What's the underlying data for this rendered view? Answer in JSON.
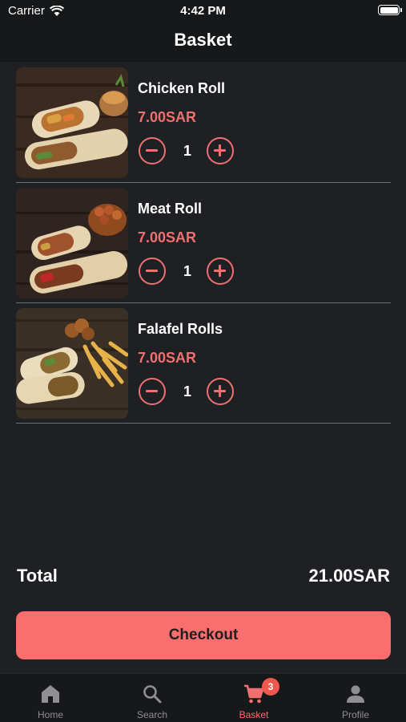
{
  "status_bar": {
    "carrier": "Carrier",
    "time": "4:42 PM"
  },
  "page": {
    "title": "Basket"
  },
  "colors": {
    "accent": "#f07070",
    "checkout_bg": "#fa6e6e",
    "background": "#1f2023",
    "badge": "#f0584f"
  },
  "basket": {
    "items": [
      {
        "name": "Chicken Roll",
        "price": "7.00SAR",
        "quantity": "1",
        "image_icon": "chicken-roll-photo"
      },
      {
        "name": "Meat Roll",
        "price": "7.00SAR",
        "quantity": "1",
        "image_icon": "meat-roll-photo"
      },
      {
        "name": "Falafel Rolls",
        "price": "7.00SAR",
        "quantity": "1",
        "image_icon": "falafel-rolls-photo"
      }
    ]
  },
  "total": {
    "label": "Total",
    "value": "21.00SAR"
  },
  "checkout": {
    "label": "Checkout"
  },
  "tab_bar": {
    "tabs": [
      {
        "label": "Home",
        "icon": "home-icon"
      },
      {
        "label": "Search",
        "icon": "search-icon"
      },
      {
        "label": "Basket",
        "icon": "cart-icon",
        "badge": "3",
        "active": true
      },
      {
        "label": "Profile",
        "icon": "person-icon"
      }
    ]
  }
}
